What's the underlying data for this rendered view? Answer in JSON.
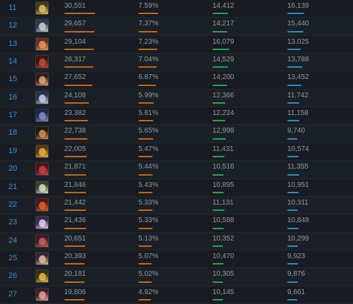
{
  "rows": [
    {
      "rank": "11",
      "games": "30,551",
      "pick_rate": "7.59%",
      "wins": "14,412",
      "losses": "16,139",
      "pick_pct": 7.59,
      "avatar_colors": [
        "#4a3a1a",
        "#e8c060"
      ]
    },
    {
      "rank": "12",
      "games": "29,657",
      "pick_rate": "7.37%",
      "wins": "14,217",
      "losses": "15,440",
      "pick_pct": 7.37,
      "avatar_colors": [
        "#2a3a55",
        "#d4d0c8"
      ]
    },
    {
      "rank": "13",
      "games": "29,104",
      "pick_rate": "7.23%",
      "wins": "16,079",
      "losses": "13,025",
      "pick_pct": 7.23,
      "avatar_colors": [
        "#6a3020",
        "#e89858"
      ]
    },
    {
      "rank": "14",
      "games": "28,317",
      "pick_rate": "7.04%",
      "wins": "14,529",
      "losses": "13,788",
      "pick_pct": 7.04,
      "avatar_colors": [
        "#3a1510",
        "#c84830"
      ]
    },
    {
      "rank": "15",
      "games": "27,652",
      "pick_rate": "6.87%",
      "wins": "14,200",
      "losses": "13,452",
      "pick_pct": 6.87,
      "avatar_colors": [
        "#2a2018",
        "#e8a070"
      ]
    },
    {
      "rank": "16",
      "games": "24,108",
      "pick_rate": "5.99%",
      "wins": "12,366",
      "losses": "11,742",
      "pick_pct": 5.99,
      "avatar_colors": [
        "#28324a",
        "#c8d0e0"
      ]
    },
    {
      "rank": "17",
      "games": "23,382",
      "pick_rate": "5.81%",
      "wins": "12,224",
      "losses": "11,158",
      "pick_pct": 5.81,
      "avatar_colors": [
        "#1a2850",
        "#8090c0"
      ]
    },
    {
      "rank": "18",
      "games": "22,738",
      "pick_rate": "5.65%",
      "wins": "12,998",
      "losses": "9,740",
      "pick_pct": 5.65,
      "avatar_colors": [
        "#201810",
        "#d89050"
      ]
    },
    {
      "rank": "19",
      "games": "22,005",
      "pick_rate": "5.47%",
      "wins": "11,431",
      "losses": "10,574",
      "pick_pct": 5.47,
      "avatar_colors": [
        "#5a3a10",
        "#f0b040"
      ]
    },
    {
      "rank": "20",
      "games": "21,871",
      "pick_rate": "5.44%",
      "wins": "10,516",
      "losses": "11,355",
      "pick_pct": 5.44,
      "avatar_colors": [
        "#501018",
        "#d04040"
      ]
    },
    {
      "rank": "21",
      "games": "21,846",
      "pick_rate": "5.43%",
      "wins": "10,895",
      "losses": "10,951",
      "pick_pct": 5.43,
      "avatar_colors": [
        "#3a4030",
        "#d8e0c0"
      ]
    },
    {
      "rank": "22",
      "games": "21,442",
      "pick_rate": "5.33%",
      "wins": "11,131",
      "losses": "10,311",
      "pick_pct": 5.33,
      "avatar_colors": [
        "#501810",
        "#e06030"
      ]
    },
    {
      "rank": "23",
      "games": "21,436",
      "pick_rate": "5.33%",
      "wins": "10,588",
      "losses": "10,848",
      "pick_pct": 5.33,
      "avatar_colors": [
        "#3a2850",
        "#e0d0e8"
      ]
    },
    {
      "rank": "24",
      "games": "20,651",
      "pick_rate": "5.13%",
      "wins": "10,352",
      "losses": "10,299",
      "pick_pct": 5.13,
      "avatar_colors": [
        "#401820",
        "#c86050"
      ]
    },
    {
      "rank": "25",
      "games": "20,393",
      "pick_rate": "5.07%",
      "wins": "10,470",
      "losses": "9,923",
      "pick_pct": 5.07,
      "avatar_colors": [
        "#302838",
        "#e8c0a0"
      ]
    },
    {
      "rank": "26",
      "games": "20,181",
      "pick_rate": "5.02%",
      "wins": "10,305",
      "losses": "9,876",
      "pick_pct": 5.02,
      "avatar_colors": [
        "#3a3010",
        "#e8c040"
      ]
    },
    {
      "rank": "27",
      "games": "19,806",
      "pick_rate": "4.92%",
      "wins": "10,145",
      "losses": "9,661",
      "pick_pct": 4.92,
      "avatar_colors": [
        "#402028",
        "#e8a090"
      ]
    }
  ],
  "colors": {
    "rank": "#3d8fd1",
    "bar_games": "#c26a16",
    "bar_wins": "#27a356",
    "bar_losses": "#2a8dc6"
  }
}
